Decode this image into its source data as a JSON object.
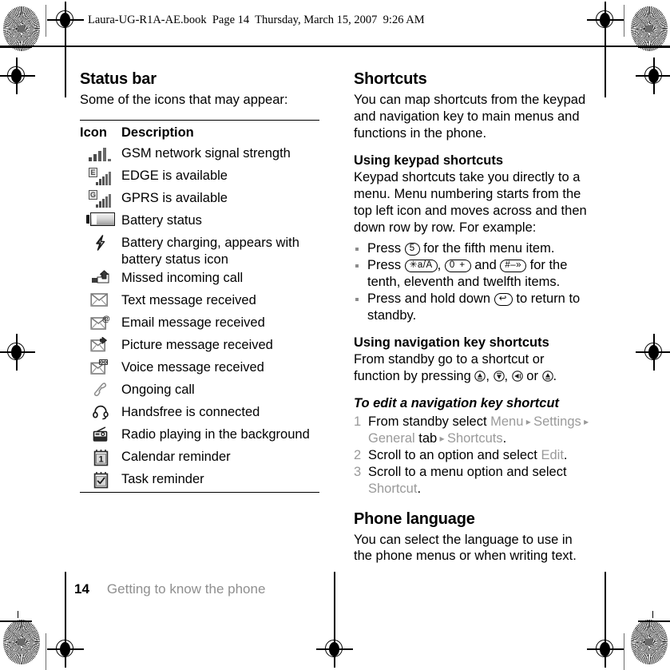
{
  "file_header": "Laura-UG-R1A-AE.book  Page 14  Thursday, March 15, 2007  9:26 AM",
  "left_column": {
    "section_title": "Status bar",
    "intro": "Some of the icons that may appear:",
    "table": {
      "header_icon": "Icon",
      "header_description": "Description",
      "rows": [
        {
          "icon": "signal-strength-icon",
          "description": "GSM network signal strength"
        },
        {
          "icon": "edge-available-icon",
          "badge": "E",
          "description": "EDGE is available"
        },
        {
          "icon": "gprs-available-icon",
          "badge": "G",
          "description": "GPRS is available"
        },
        {
          "icon": "battery-status-icon",
          "description": "Battery status"
        },
        {
          "icon": "battery-charging-icon",
          "description": "Battery charging, appears with battery status icon"
        },
        {
          "icon": "missed-call-icon",
          "description": "Missed incoming call"
        },
        {
          "icon": "text-message-icon",
          "description": "Text message received"
        },
        {
          "icon": "email-message-icon",
          "description": "Email message received"
        },
        {
          "icon": "picture-message-icon",
          "description": "Picture message received"
        },
        {
          "icon": "voice-message-icon",
          "description": "Voice message received"
        },
        {
          "icon": "ongoing-call-icon",
          "description": "Ongoing call"
        },
        {
          "icon": "handsfree-icon",
          "description": "Handsfree is connected"
        },
        {
          "icon": "radio-icon",
          "description": "Radio playing in the background"
        },
        {
          "icon": "calendar-reminder-icon",
          "description": "Calendar reminder"
        },
        {
          "icon": "task-reminder-icon",
          "description": "Task reminder"
        }
      ]
    }
  },
  "right_column": {
    "section_title": "Shortcuts",
    "intro": "You can map shortcuts from the keypad and navigation key to main menus and functions in the phone.",
    "keypad_heading": "Using keypad shortcuts",
    "keypad_body": "Keypad shortcuts take you directly to a menu. Menu numbering starts from the top left icon and moves across and then down row by row. For example:",
    "bullets": [
      {
        "pre": "Press ",
        "keys": [
          "5"
        ],
        "post": " for the fifth menu item."
      },
      {
        "pre": "Press ",
        "keys": [
          "✳a/A",
          "0 +",
          "#–»"
        ],
        "post": " for the tenth, eleventh and twelfth items."
      },
      {
        "pre": "Press and hold down ",
        "keys": [
          "↩"
        ],
        "post": " to return to standby."
      }
    ],
    "bullet2_joiner_1": ", ",
    "bullet2_joiner_2": " and ",
    "nav_heading": "Using navigation key shortcuts",
    "nav_body_pre": "From standby go to a shortcut or function by pressing ",
    "nav_keys": [
      "nav-up-icon",
      "nav-down-icon",
      "nav-left-icon",
      "nav-right-icon"
    ],
    "nav_sep_1": ", ",
    "nav_sep_2": ", ",
    "nav_sep_3": " or ",
    "nav_body_post": ".",
    "procedure_heading": "To edit a navigation key shortcut",
    "steps": [
      {
        "parts": [
          {
            "text": "From standby select ",
            "style": "plain"
          },
          {
            "text": "Menu",
            "style": "ui"
          },
          {
            "text": " ▸ ",
            "style": "arrow"
          },
          {
            "text": "Settings",
            "style": "ui"
          },
          {
            "text": " ▸ ",
            "style": "arrow"
          },
          {
            "text": "General",
            "style": "ui"
          },
          {
            "text": " tab",
            "style": "plain"
          },
          {
            "text": " ▸ ",
            "style": "arrow"
          },
          {
            "text": "Shortcuts",
            "style": "ui"
          },
          {
            "text": ".",
            "style": "plain"
          }
        ]
      },
      {
        "parts": [
          {
            "text": "Scroll to an option and select ",
            "style": "plain"
          },
          {
            "text": "Edit",
            "style": "ui"
          },
          {
            "text": ".",
            "style": "plain"
          }
        ]
      },
      {
        "parts": [
          {
            "text": "Scroll to a menu option and select ",
            "style": "plain"
          },
          {
            "text": "Shortcut",
            "style": "ui"
          },
          {
            "text": ".",
            "style": "plain"
          }
        ]
      }
    ],
    "language_heading": "Phone language",
    "language_body": "You can select the language to use in the phone menus or when writing text."
  },
  "footer": {
    "page_number": "14",
    "chapter": "Getting to know the phone"
  },
  "colors": {
    "ui_term_gray": "#9a9a9a",
    "footer_chapter_gray": "#8f8f8f",
    "bullet_gray": "#8c8c8c",
    "icon_gray": "#555555",
    "text_black": "#000000"
  }
}
